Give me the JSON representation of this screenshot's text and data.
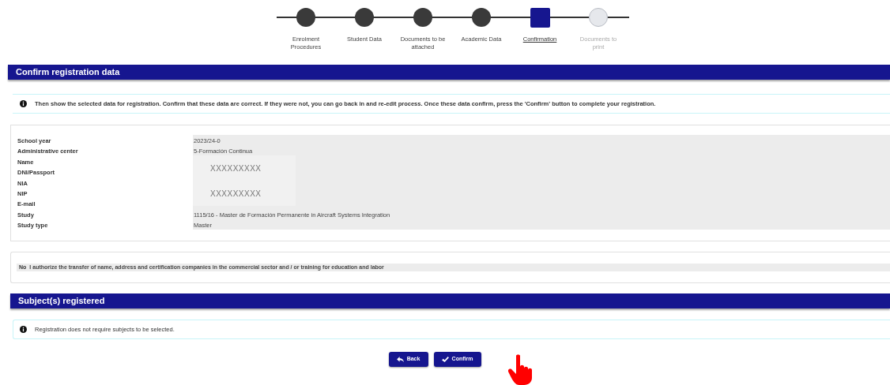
{
  "steps": [
    {
      "label": "Enrolment Procedures",
      "kind": "done",
      "selected": false
    },
    {
      "label": "Student Data",
      "kind": "done",
      "selected": false
    },
    {
      "label": "Documents to be attached",
      "kind": "done",
      "selected": false
    },
    {
      "label": "Academic Data",
      "kind": "done",
      "selected": false
    },
    {
      "label": "Confirmation",
      "kind": "current",
      "selected": true
    },
    {
      "label": "Documents to print",
      "kind": "pending",
      "selected": false
    }
  ],
  "confirm_section": {
    "title": "Confirm registration data",
    "notice": "Then show the selected data for registration. Confirm that these data are correct. If they were not, you can go back in and re-edit process. Once these data confirm, press the 'Confirm' button to complete your registration."
  },
  "fields": [
    {
      "label": "School year",
      "value": "2023/24-0"
    },
    {
      "label": "Administrative center",
      "value": "5-Formación Continua"
    },
    {
      "label": "Name"
    },
    {
      "label": "DNI/Passport"
    },
    {
      "label": "NIA"
    },
    {
      "label": "NIP"
    },
    {
      "label": "E-mail"
    },
    {
      "label": "Study",
      "value": "1115/16 - Master de Formación Permanente in Aircraft Systems Integration"
    },
    {
      "label": "Study type",
      "value": "Master"
    }
  ],
  "redactions": [
    "XXXXXXXXX",
    "XXXXXXXXX"
  ],
  "authorization": {
    "answer": "No",
    "text": "I authorize the transfer of name, address and certification companies in the commercial sector and / or training for education and labor"
  },
  "subjects_section": {
    "title": "Subject(s) registered",
    "notice": "Registration does not require subjects to be selected."
  },
  "buttons": [
    {
      "label": "Back",
      "kind": "back"
    },
    {
      "label": "Confirm",
      "kind": "confirm"
    }
  ]
}
